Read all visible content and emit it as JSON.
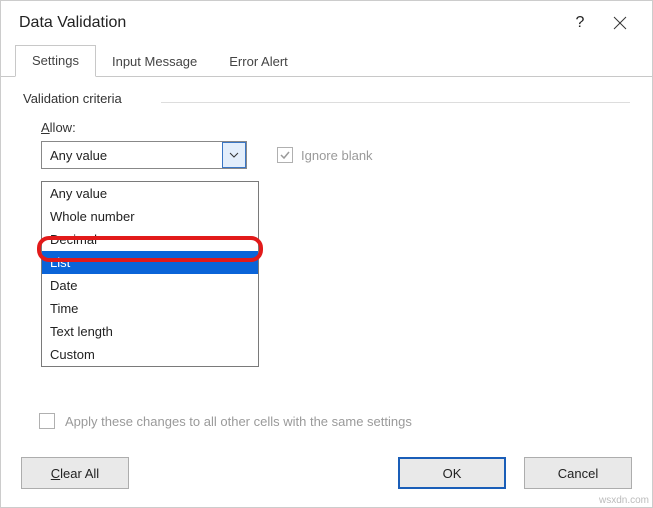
{
  "title": "Data Validation",
  "help_glyph": "?",
  "tabs": [
    {
      "label": "Settings",
      "active": true
    },
    {
      "label": "Input Message",
      "active": false
    },
    {
      "label": "Error Alert",
      "active": false
    }
  ],
  "criteria_label": "Validation criteria",
  "allow_label_pre": "A",
  "allow_label_post": "llow:",
  "allow_value": "Any value",
  "ignore_blank_label": "Ignore blank",
  "allow_options": [
    {
      "label": "Any value",
      "selected": false
    },
    {
      "label": "Whole number",
      "selected": false
    },
    {
      "label": "Decimal",
      "selected": false
    },
    {
      "label": "List",
      "selected": true
    },
    {
      "label": "Date",
      "selected": false
    },
    {
      "label": "Time",
      "selected": false
    },
    {
      "label": "Text length",
      "selected": false
    },
    {
      "label": "Custom",
      "selected": false
    }
  ],
  "apply_label": "Apply these changes to all other cells with the same settings",
  "buttons": {
    "clear_pre": "C",
    "clear_post": "lear All",
    "ok": "OK",
    "cancel": "Cancel"
  },
  "watermark": "wsxdn.com"
}
